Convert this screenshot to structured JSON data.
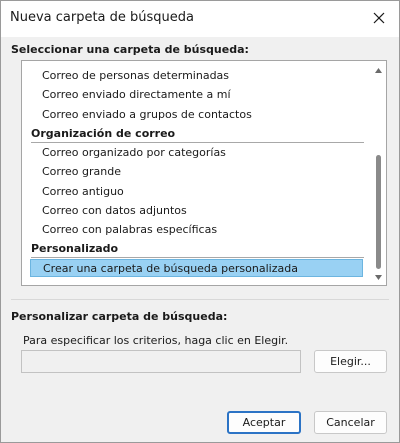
{
  "dialog": {
    "title": "Nueva carpeta de búsqueda",
    "close_icon": "close-icon"
  },
  "select_section": {
    "label": "Seleccionar una carpeta de búsqueda:"
  },
  "list": {
    "rows": [
      {
        "type": "item",
        "text": "Correo de personas determinadas"
      },
      {
        "type": "item",
        "text": "Correo enviado directamente a mí"
      },
      {
        "type": "item",
        "text": "Correo enviado a grupos de contactos"
      },
      {
        "type": "group",
        "text": "Organización de correo"
      },
      {
        "type": "item",
        "text": "Correo organizado por categorías"
      },
      {
        "type": "item",
        "text": "Correo grande"
      },
      {
        "type": "item",
        "text": "Correo antiguo"
      },
      {
        "type": "item",
        "text": "Correo con datos adjuntos"
      },
      {
        "type": "item",
        "text": "Correo con palabras específicas"
      },
      {
        "type": "group",
        "text": "Personalizado"
      },
      {
        "type": "item",
        "text": "Crear una carpeta de búsqueda personalizada",
        "selected": true
      }
    ]
  },
  "customize_section": {
    "label": "Personalizar carpeta de búsqueda:",
    "instructions": "Para especificar los criterios, haga clic en Elegir.",
    "criteria_value": "",
    "choose_button": "Elegir..."
  },
  "footer": {
    "ok_button": "Aceptar",
    "cancel_button": "Cancelar"
  },
  "colors": {
    "selection": "#99d1f3",
    "primary_border": "#2b73c5"
  }
}
